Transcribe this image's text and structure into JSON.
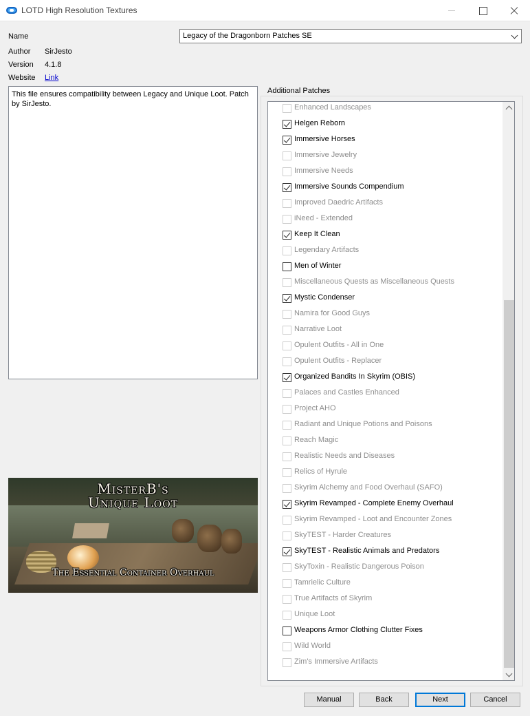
{
  "window": {
    "title": "LOTD High Resolution Textures"
  },
  "details": {
    "name_label": "Name",
    "name_value": "Legacy of the Dragonborn Patches SE",
    "author_label": "Author",
    "author_value": "SirJesto",
    "version_label": "Version",
    "version_value": "4.1.8",
    "website_label": "Website",
    "website_link": "Link",
    "description": "This file ensures compatibility between Legacy and Unique Loot. Patch by SirJesto."
  },
  "banner": {
    "line1": "MisterB's",
    "line2": "Unique Loot",
    "line3": "The Essential Container Overhaul"
  },
  "patches": {
    "title": "Additional Patches",
    "items": [
      {
        "label": "Enhanced Landscapes",
        "checked": false,
        "enabled": false
      },
      {
        "label": "Helgen Reborn",
        "checked": true,
        "enabled": true
      },
      {
        "label": "Immersive Horses",
        "checked": true,
        "enabled": true
      },
      {
        "label": "Immersive Jewelry",
        "checked": false,
        "enabled": false
      },
      {
        "label": "Immersive Needs",
        "checked": false,
        "enabled": false
      },
      {
        "label": "Immersive Sounds Compendium",
        "checked": true,
        "enabled": true
      },
      {
        "label": "Improved Daedric Artifacts",
        "checked": false,
        "enabled": false
      },
      {
        "label": "iNeed - Extended",
        "checked": false,
        "enabled": false
      },
      {
        "label": "Keep It Clean",
        "checked": true,
        "enabled": true
      },
      {
        "label": "Legendary Artifacts",
        "checked": false,
        "enabled": false
      },
      {
        "label": "Men of Winter",
        "checked": false,
        "enabled": true
      },
      {
        "label": "Miscellaneous Quests as Miscellaneous Quests",
        "checked": false,
        "enabled": false
      },
      {
        "label": "Mystic Condenser",
        "checked": true,
        "enabled": true
      },
      {
        "label": "Namira for Good Guys",
        "checked": false,
        "enabled": false
      },
      {
        "label": "Narrative Loot",
        "checked": false,
        "enabled": false
      },
      {
        "label": "Opulent Outfits - All in One",
        "checked": false,
        "enabled": false
      },
      {
        "label": "Opulent Outfits - Replacer",
        "checked": false,
        "enabled": false
      },
      {
        "label": "Organized Bandits In Skyrim (OBIS)",
        "checked": true,
        "enabled": true
      },
      {
        "label": "Palaces and Castles Enhanced",
        "checked": false,
        "enabled": false
      },
      {
        "label": "Project AHO",
        "checked": false,
        "enabled": false
      },
      {
        "label": "Radiant and Unique Potions and Poisons",
        "checked": false,
        "enabled": false
      },
      {
        "label": "Reach Magic",
        "checked": false,
        "enabled": false
      },
      {
        "label": "Realistic Needs and Diseases",
        "checked": false,
        "enabled": false
      },
      {
        "label": "Relics of Hyrule",
        "checked": false,
        "enabled": false
      },
      {
        "label": "Skyrim Alchemy and Food Overhaul (SAFO)",
        "checked": false,
        "enabled": false
      },
      {
        "label": "Skyrim Revamped - Complete Enemy Overhaul",
        "checked": true,
        "enabled": true
      },
      {
        "label": "Skyrim Revamped - Loot and Encounter Zones",
        "checked": false,
        "enabled": false
      },
      {
        "label": "SkyTEST - Harder Creatures",
        "checked": false,
        "enabled": false
      },
      {
        "label": "SkyTEST - Realistic Animals and Predators",
        "checked": true,
        "enabled": true
      },
      {
        "label": "SkyToxin - Realistic Dangerous Poison",
        "checked": false,
        "enabled": false
      },
      {
        "label": "Tamrielic Culture",
        "checked": false,
        "enabled": false
      },
      {
        "label": "True Artifacts of Skyrim",
        "checked": false,
        "enabled": false
      },
      {
        "label": "Unique Loot",
        "checked": false,
        "enabled": false
      },
      {
        "label": "Weapons Armor Clothing Clutter Fixes",
        "checked": false,
        "enabled": true
      },
      {
        "label": "Wild World",
        "checked": false,
        "enabled": false
      },
      {
        "label": "Zim's Immersive Artifacts",
        "checked": false,
        "enabled": false
      }
    ]
  },
  "buttons": {
    "manual": "Manual",
    "back": "Back",
    "next": "Next",
    "cancel": "Cancel"
  }
}
